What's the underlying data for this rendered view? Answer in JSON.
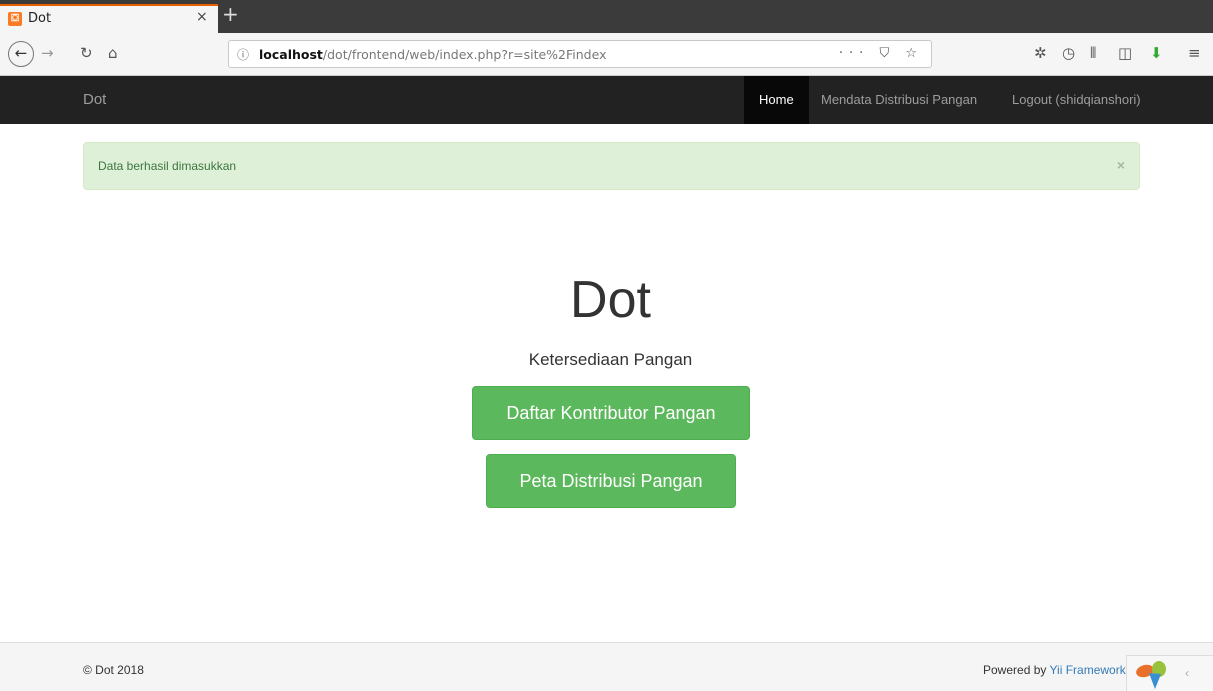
{
  "browser": {
    "tab_title": "Dot",
    "tab_icon": "xampp-icon",
    "url_host": "localhost",
    "url_path": "/dot/frontend/web/index.php?r=site%2Findex",
    "url_actions": "··· ⛉ ☆"
  },
  "site": {
    "brand": "Dot",
    "nav": {
      "home": "Home",
      "mendata": "Mendata Distribusi Pangan",
      "logout": "Logout (shidqianshori)"
    },
    "alert": {
      "text": "Data berhasil dimasukkan",
      "close": "×"
    },
    "jumbotron": {
      "title": "Dot",
      "subtitle": "Ketersediaan Pangan",
      "btn_kontributor": "Daftar Kontributor Pangan",
      "btn_peta": "Peta Distribusi Pangan"
    },
    "footer": {
      "copyright": "© Dot 2018",
      "powered_prefix": "Powered by ",
      "powered_link": "Yii Framework"
    }
  },
  "colors": {
    "navbar": "#222222",
    "success_button": "#5cb85c",
    "alert_bg": "#dff0d8"
  }
}
